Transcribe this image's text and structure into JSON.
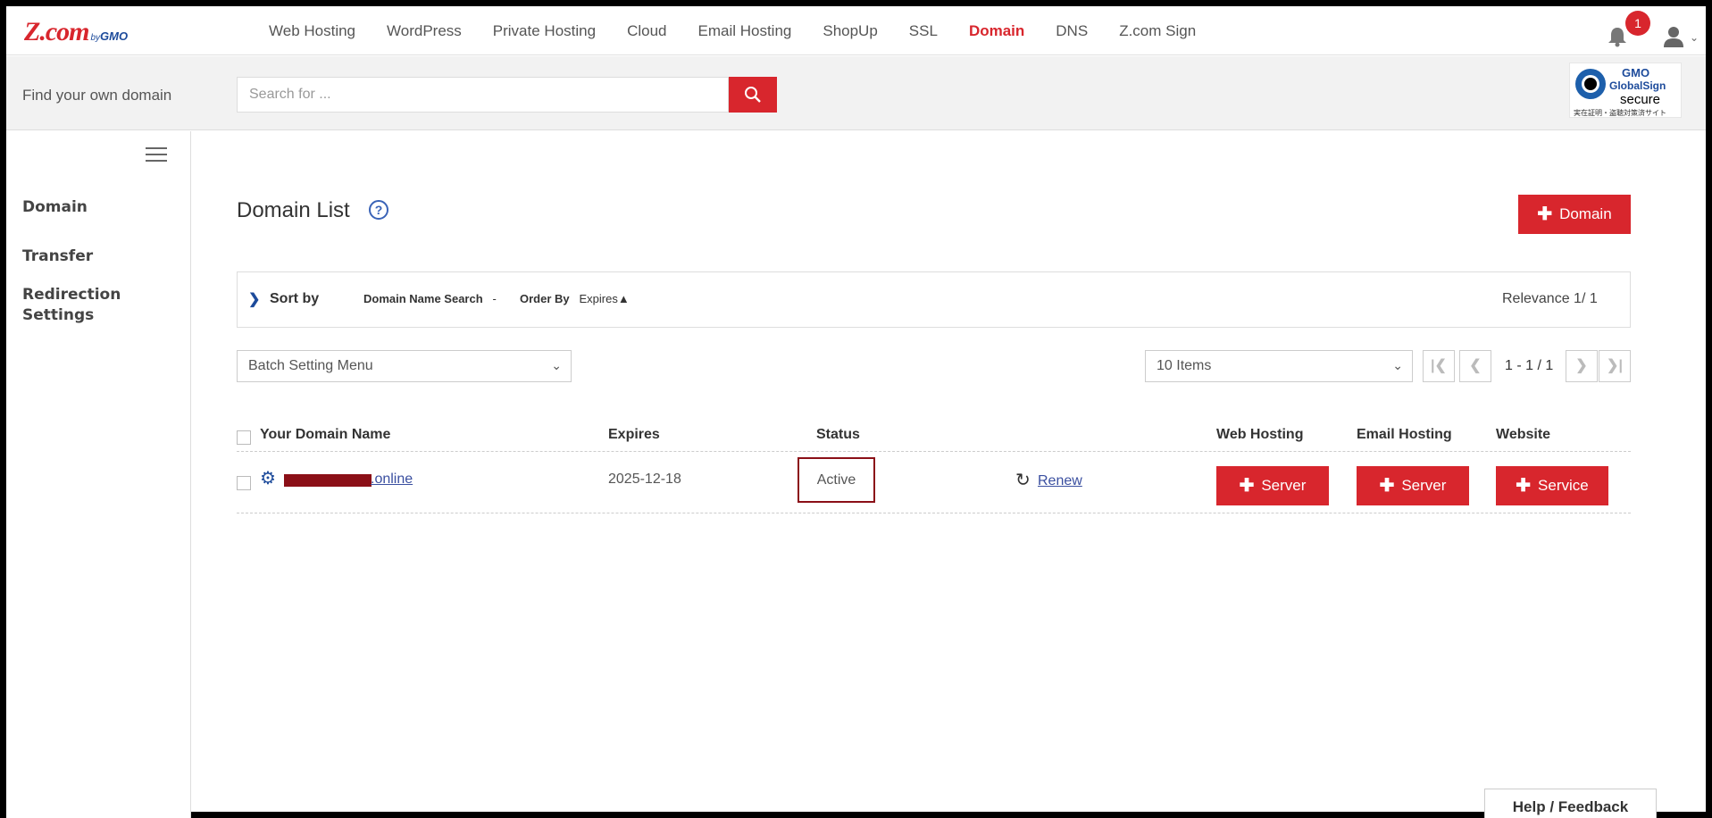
{
  "brand": {
    "logo_main": "Z.com",
    "logo_by": "by",
    "logo_gmo": "GMO",
    "accent": "#d8262d"
  },
  "nav": {
    "links": [
      "Web Hosting",
      "WordPress",
      "Private Hosting",
      "Cloud",
      "Email Hosting",
      "ShopUp",
      "SSL",
      "Domain",
      "DNS",
      "Z.com Sign"
    ],
    "active": "Domain",
    "notification_count": "1"
  },
  "search": {
    "label": "Find your own domain",
    "placeholder": "Search for ..."
  },
  "globalsign": {
    "gmo": "GMO",
    "name": "GlobalSign",
    "secure": "secure",
    "small": "実在証明・盗聴対策済サイト"
  },
  "sidebar": {
    "items": [
      "Domain",
      "Transfer",
      "Redirection Settings"
    ]
  },
  "main": {
    "title": "Domain List",
    "help": "?",
    "add_button": "Domain",
    "sort": {
      "label": "Sort by",
      "field1_name": "Domain Name Search",
      "field1_value": "-",
      "field2_name": "Order By",
      "field2_value": "Expires▲",
      "relevance": "Relevance 1/ 1"
    },
    "batch_menu": "Batch Setting Menu",
    "items_per_page": "10 Items",
    "pager": {
      "range": "1 - 1 / 1",
      "first": "|❮",
      "prev": "❮",
      "next": "❯",
      "last": "❯|"
    },
    "columns": [
      "Your Domain Name",
      "Expires",
      "Status",
      "Web Hosting",
      "Email Hosting",
      "Website"
    ],
    "rows": [
      {
        "domain": ".online",
        "expires": "2025-12-18",
        "status": "Active",
        "renew": "Renew",
        "web_hosting": "Server",
        "email_hosting": "Server",
        "website": "Service"
      }
    ]
  },
  "footer": {
    "help_feedback": "Help / Feedback"
  }
}
